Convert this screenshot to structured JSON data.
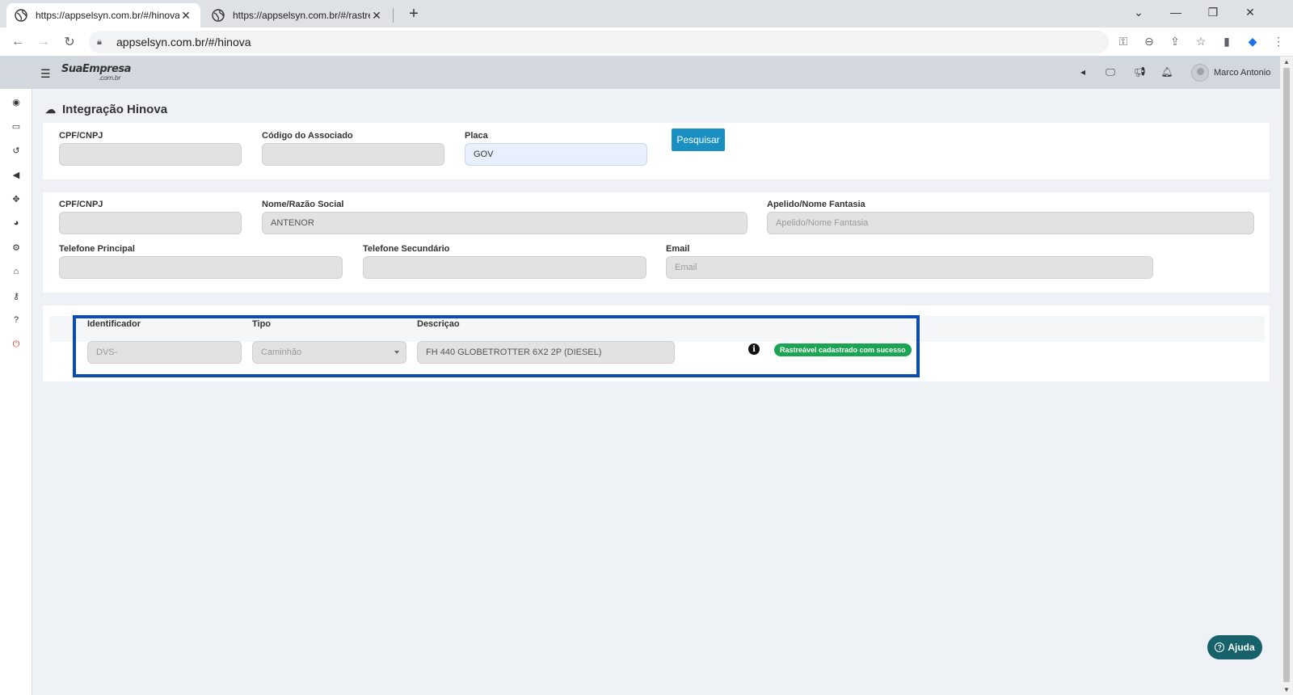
{
  "browser": {
    "tabs": [
      {
        "title": "https://appselsyn.com.br/#/hinova"
      },
      {
        "title": "https://appselsyn.com.br/#/rastreaveis"
      }
    ],
    "new_tab_label": "+",
    "address": "appselsyn.com.br/#/hinova"
  },
  "app": {
    "logo_main": "SuaEmpresa",
    "logo_sub": ".com.br",
    "username": "Marco Antonio",
    "page_title": "Integração Hinova",
    "search": {
      "cpf_label": "CPF/CNPJ",
      "cpf_value": "",
      "codigo_label": "Código do Associado",
      "codigo_value": "",
      "placa_label": "Placa",
      "placa_value": "GOV",
      "button_label": "Pesquisar"
    },
    "details": {
      "cpf_label": "CPF/CNPJ",
      "cpf_value": "",
      "nome_label": "Nome/Razão Social",
      "nome_value": "ANTENOR",
      "apelido_label": "Apelido/Nome Fantasia",
      "apelido_placeholder": "Apelido/Nome Fantasia",
      "tel1_label": "Telefone Principal",
      "tel1_value": "",
      "tel2_label": "Telefone Secundário",
      "tel2_value": "",
      "email_label": "Email",
      "email_placeholder": "Email"
    },
    "vehicles": {
      "headers": {
        "identificador": "Identificador",
        "tipo": "Tipo",
        "descricao": "Descriçao"
      },
      "rows": [
        {
          "identificador": "DVS-",
          "tipo": "Caminhão",
          "descricao": "FH 440 GLOBETROTTER 6X2 2P (DIESEL)",
          "status": "Rastreável cadastrado com sucesso"
        }
      ]
    },
    "help_label": "Ajuda"
  },
  "colors": {
    "primary_button": "#1a8fc2",
    "success_badge": "#1aa552",
    "highlight_border": "#0b4dac",
    "help_button": "#16616a"
  }
}
